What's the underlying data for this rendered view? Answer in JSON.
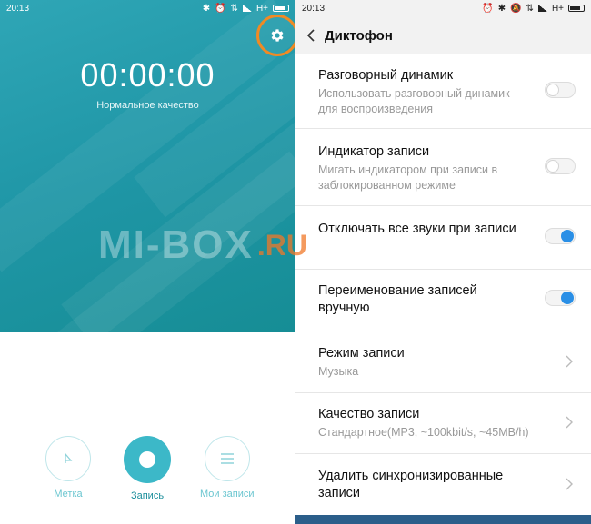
{
  "left": {
    "status": {
      "time": "20:13",
      "network": "H+"
    },
    "timer": "00:00:00",
    "quality": "Нормальное качество",
    "controls": [
      {
        "label": "Метка",
        "icon": "flag-icon"
      },
      {
        "label": "Запись",
        "icon": "record-icon"
      },
      {
        "label": "Мои записи",
        "icon": "list-icon"
      }
    ]
  },
  "right": {
    "status": {
      "time": "20:13",
      "network": "H+"
    },
    "header": {
      "title": "Диктофон"
    },
    "items": [
      {
        "title": "Разговорный динамик",
        "subtitle": "Использовать разговорный динамик для воспроизведения",
        "control": "toggle-off"
      },
      {
        "title": "Индикатор записи",
        "subtitle": "Мигать индикатором при записи в заблокированном режиме",
        "control": "toggle-off"
      },
      {
        "title": "Отключать все звуки при записи",
        "subtitle": "",
        "control": "toggle-on"
      },
      {
        "title": "Переименование записей вручную",
        "subtitle": "",
        "control": "toggle-on"
      },
      {
        "title": "Режим записи",
        "subtitle": "Музыка",
        "control": "chevron"
      },
      {
        "title": "Качество записи",
        "subtitle": "Стандартное(MP3, ~100kbit/s, ~45MB/h)",
        "control": "chevron"
      },
      {
        "title": "Удалить синхронизированные записи",
        "subtitle": "",
        "control": "chevron"
      }
    ]
  },
  "watermark": {
    "text": "MI-BOX",
    "suffix": ".RU"
  },
  "colors": {
    "teal": "#1f96a6",
    "accent": "#3cb8c8",
    "toggle_on": "#2a8fe6",
    "highlight": "#f08a24"
  }
}
